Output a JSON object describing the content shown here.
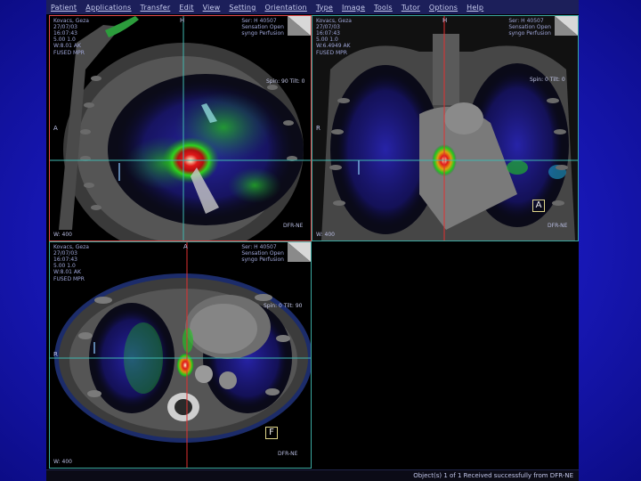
{
  "menu": [
    "Patient",
    "Applications",
    "Transfer",
    "Edit",
    "View",
    "Setting",
    "Orientation",
    "Type",
    "Image",
    "Tools",
    "Tutor",
    "Options",
    "Help"
  ],
  "viewports": {
    "sagittal": {
      "patient_info": "Kovacs, Geza\n27/07/03\n16:07:43\n5.00 1.0\nW:8.01 AK",
      "study_info": "Ser: H 40507\nSensation Open\nsyngo Perfusion",
      "fused": "FUSED MPR",
      "orientation_top": "H",
      "orientation_left": "A",
      "spin": "Spin: 90\nTilt: 0",
      "wl": "W: 400",
      "dcode": "DFR-NE"
    },
    "coronal": {
      "patient_info": "Kovacs, Geza\n27/07/03\n16:07:43\n5.00 1.0\nW:6.4949 AK",
      "study_info": "Ser: H 40507\nSensation Open\nsyngo Perfusion",
      "fused": "FUSED MPR",
      "orientation_top": "H",
      "orientation_left": "R",
      "spin": "Spin: 0\nTilt: 0",
      "box_label": "A",
      "wl": "W: 400",
      "dcode": "DFR-NE"
    },
    "axial": {
      "patient_info": "Kovacs, Geza\n27/07/03\n16:07:43\n5.00 1.0\nW:8.01 AK",
      "study_info": "Ser: H 40507\nSensation Open\nsyngo Perfusion",
      "fused": "FUSED MPR",
      "orientation_top": "A",
      "orientation_left": "R",
      "spin": "Spin: 0\nTilt: 90",
      "box_label": "F",
      "wl": "W: 400",
      "dcode": "DFR-NE"
    }
  },
  "status": "Object(s) 1 of 1 Received successfully from DFR-NE",
  "colors": {
    "active_border": "#e24a4a",
    "inactive_border": "#3ba8a0",
    "crosshair_red": "#e23030",
    "crosshair_teal": "#3fb8b0",
    "background_blue": "#1818b8"
  }
}
